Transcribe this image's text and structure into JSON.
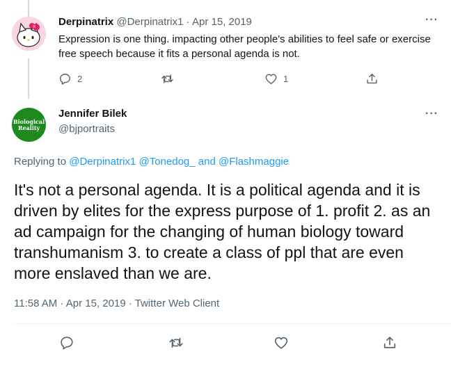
{
  "tweet1": {
    "name": "Derpinatrix",
    "handle": "@Derpinatrix1",
    "separator": "·",
    "date": "Apr 15, 2019",
    "text": "Expression is one thing. impacting other people's abilities to feel safe or exercise free speech because it fits a personal agenda is not.",
    "reply_count": "2",
    "retweet_count": "",
    "like_count": "1",
    "more": "···"
  },
  "tweet2": {
    "name": "Jennifer Bilek",
    "handle": "@bjportraits",
    "avatar_text_1": "Biological",
    "avatar_text_2": "Reality",
    "more": "···",
    "replying_prefix": "Replying to",
    "replying_user1": "@Derpinatrix1",
    "replying_user2": "@Tonedog_",
    "replying_and": "and",
    "replying_user3": "@Flashmaggie",
    "text": "It's not a personal agenda.  It is a political agenda and it is driven by elites for the express purpose of 1. profit  2. as an ad campaign for the changing of human biology toward transhumanism 3. to create a class of ppl that are even more enslaved than we are.",
    "time": "11:58 AM",
    "date": "Apr 15, 2019",
    "client": "Twitter Web Client",
    "sep": "·"
  },
  "colors": {
    "accent": "#1d9bf0",
    "muted": "#536471",
    "avatar_green": "#1e8a1e"
  },
  "icons": [
    "reply-icon",
    "retweet-icon",
    "like-icon",
    "share-icon",
    "more-icon"
  ]
}
